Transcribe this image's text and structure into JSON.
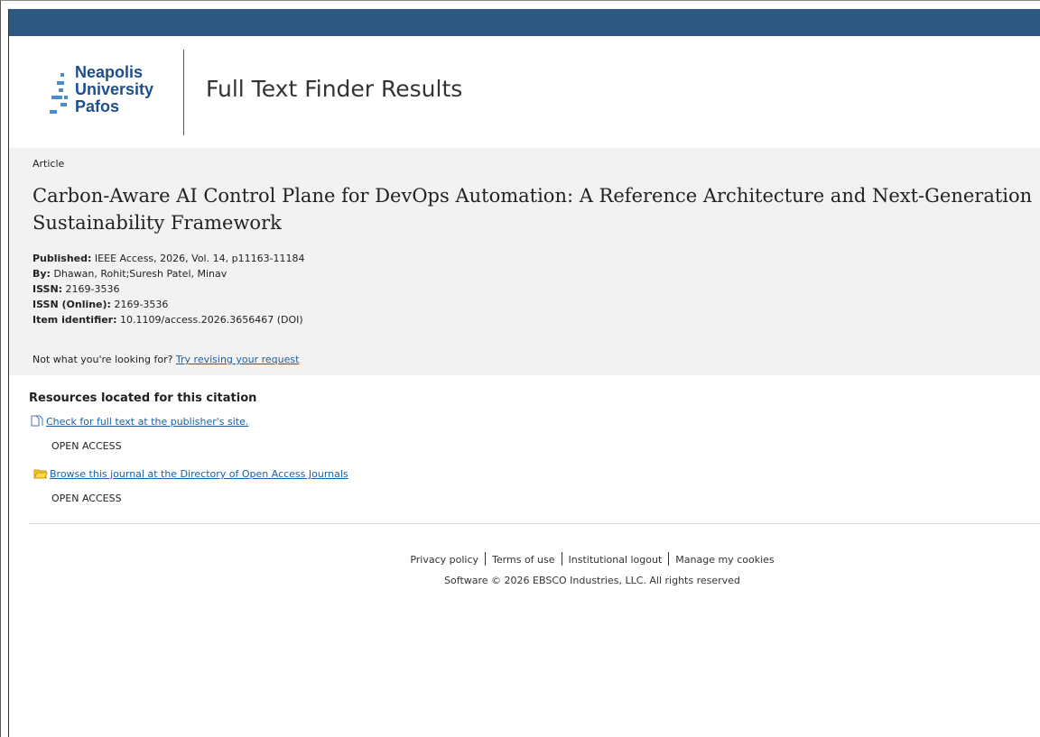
{
  "header": {
    "logo_lines": [
      "Neapolis",
      "University",
      "Pafos"
    ],
    "title": "Full Text Finder Results"
  },
  "citation": {
    "type": "Article",
    "title_line1": "Carbon-Aware AI Control Plane for DevOps Automation: A Reference Architecture and Next-Generation",
    "title_line2": "Sustainability Framework",
    "published_label": "Published:",
    "published_value": " IEEE Access, 2026, Vol. 14, p11163-11184",
    "by_label": "By:",
    "by_value": " Dhawan, Rohit;Suresh Patel, Minav",
    "issn_label": "ISSN:",
    "issn_value": " 2169-3536",
    "issn_online_label": "ISSN (Online):",
    "issn_online_value": " 2169-3536",
    "item_id_label": "Item identifier:",
    "item_id_value": " 10.1109/access.2026.3656467 (DOI)",
    "not_looking_text": "Not what you're looking for? ",
    "not_looking_link": "Try revising your request"
  },
  "resources": {
    "heading": "Resources located for this citation",
    "items": [
      {
        "link": "Check for full text at the publisher's site.",
        "access": "OPEN ACCESS",
        "icon": "document-icon"
      },
      {
        "link": "Browse this journal at the Directory of Open Access Journals",
        "access": "OPEN ACCESS",
        "icon": "folder-icon"
      }
    ]
  },
  "footer": {
    "links": [
      "Privacy policy",
      "Terms of use",
      "Institutional logout",
      "Manage my cookies"
    ],
    "copyright": "Software © 2026 EBSCO Industries, LLC. All rights reserved"
  },
  "colors": {
    "topbar": "#2e5a82",
    "link": "#1a5fa8",
    "logo": "#1f4e8c"
  }
}
